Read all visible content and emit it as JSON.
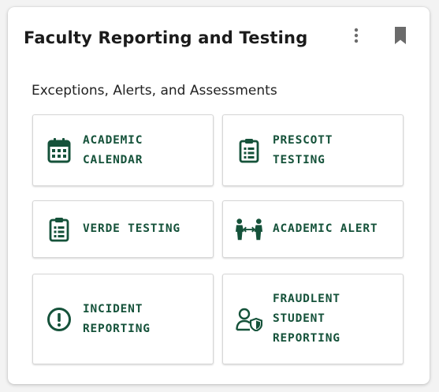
{
  "card": {
    "title": "Faculty Reporting and Testing",
    "more_icon": "more-vert-icon",
    "bookmark_icon": "bookmark-icon"
  },
  "section": {
    "label": "Exceptions, Alerts, and Assessments"
  },
  "tiles": [
    {
      "label": "ACADEMIC\nCALENDAR",
      "icon": "calendar-icon"
    },
    {
      "label": "PRESCOTT\nTESTING",
      "icon": "clipboard-list-icon"
    },
    {
      "label": "VERDE TESTING",
      "icon": "clipboard-list-icon"
    },
    {
      "label": "ACADEMIC ALERT",
      "icon": "people-exchange-icon"
    },
    {
      "label": "INCIDENT\nREPORTING",
      "icon": "exclamation-circle-icon"
    },
    {
      "label": "FRAUDLENT\nSTUDENT\nREPORTING",
      "icon": "user-shield-icon"
    }
  ],
  "colors": {
    "accent": "#15523a",
    "icon_grey": "#6b6b6b",
    "card_bg": "#ffffff",
    "page_bg": "#f3f3f3"
  }
}
